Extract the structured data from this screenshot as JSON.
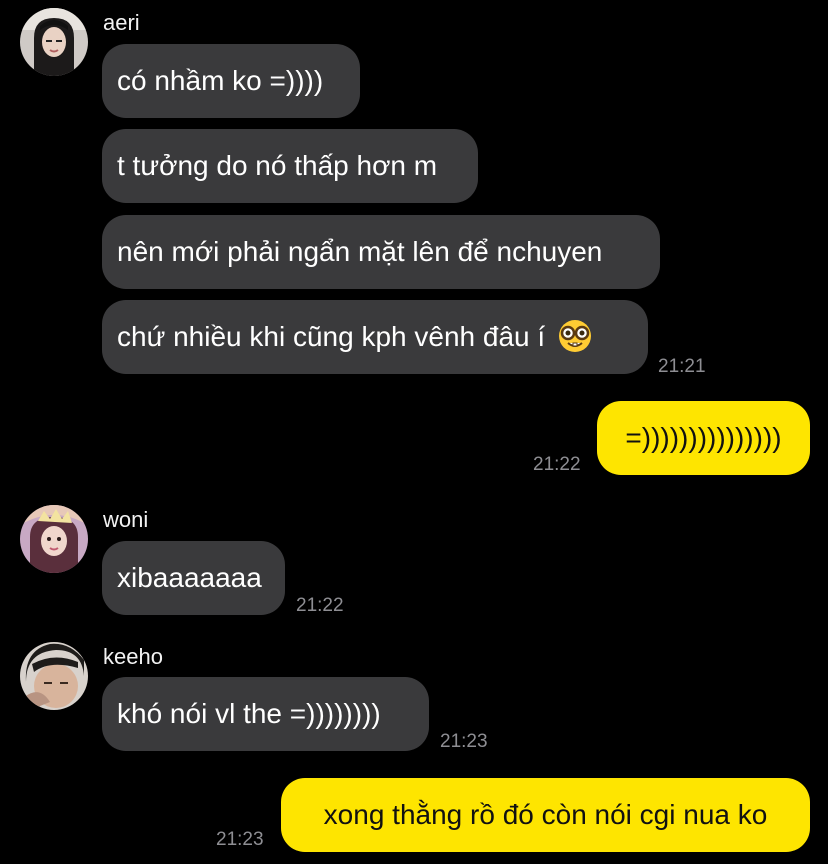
{
  "colors": {
    "background": "#000000",
    "incoming_bubble": "#3a3a3c",
    "outgoing_bubble": "#fee500",
    "timestamp": "#8e8e93"
  },
  "chat": {
    "group1": {
      "sender": "aeri",
      "avatar_icon": "profile-photo-aeri",
      "messages": [
        "có nhầm ko =))))",
        "t tưởng do nó thấp hơn m",
        "nên mới phải ngẩn mặt lên để nchuyen",
        "chứ nhiều khi cũng kph vênh đâu í"
      ],
      "emoji_icon": "nerd-face-emoji",
      "time": "21:21"
    },
    "out1": {
      "text": "=)))))))))))))))",
      "time": "21:22"
    },
    "group2": {
      "sender": "woni",
      "avatar_icon": "profile-photo-woni",
      "message": "xibaaaaaaa",
      "time": "21:22"
    },
    "group3": {
      "sender": "keeho",
      "avatar_icon": "profile-photo-keeho",
      "message": "khó nói vl the =))))))))",
      "time": "21:23"
    },
    "out2": {
      "text": "xong thằng rồ đó còn nói cgi nua ko",
      "time": "21:23"
    }
  }
}
